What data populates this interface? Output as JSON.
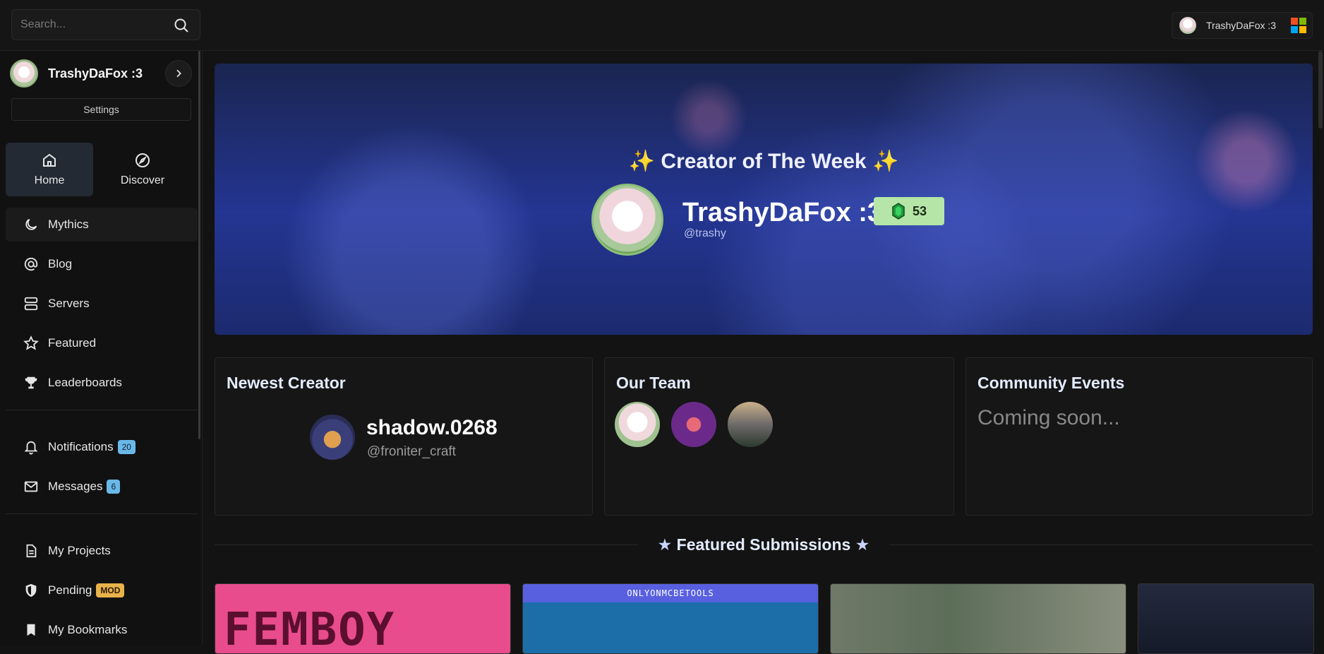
{
  "search": {
    "placeholder": "Search..."
  },
  "account": {
    "name": "TrashyDaFox :3"
  },
  "sidebar": {
    "profile_name": "TrashyDaFox :3",
    "settings_label": "Settings",
    "tiles": [
      {
        "label": "Home",
        "icon": "home-icon",
        "active": true
      },
      {
        "label": "Discover",
        "icon": "compass-icon",
        "active": false
      }
    ],
    "items": [
      {
        "label": "Mythics",
        "icon": "moon-icon"
      },
      {
        "label": "Blog",
        "icon": "at-icon"
      },
      {
        "label": "Servers",
        "icon": "server-icon"
      },
      {
        "label": "Featured",
        "icon": "star-icon"
      },
      {
        "label": "Leaderboards",
        "icon": "trophy-icon"
      }
    ],
    "notifications": {
      "label": "Notifications",
      "count": "20"
    },
    "messages": {
      "label": "Messages",
      "count": "6"
    },
    "projects": {
      "label": "My Projects"
    },
    "pending": {
      "label": "Pending",
      "badge": "MOD"
    },
    "bookmarks": {
      "label": "My Bookmarks"
    }
  },
  "hero": {
    "title": "Creator of The Week",
    "name": "TrashyDaFox :3",
    "handle": "@trashy",
    "gems": "53"
  },
  "newest_creator": {
    "heading": "Newest Creator",
    "name": "shadow.0268",
    "handle": "@froniter_craft"
  },
  "team": {
    "heading": "Our Team"
  },
  "events": {
    "heading": "Community Events",
    "text": "Coming soon..."
  },
  "featured": {
    "heading": "Featured Submissions",
    "thumb1_text": "FEMBOY",
    "thumb2_banner": "ONLYONMCBETOOLS"
  },
  "colors": {
    "accent": "#6ab8e8",
    "gem_badge": "#b5e6a8",
    "mod_badge": "#e8b24a"
  }
}
